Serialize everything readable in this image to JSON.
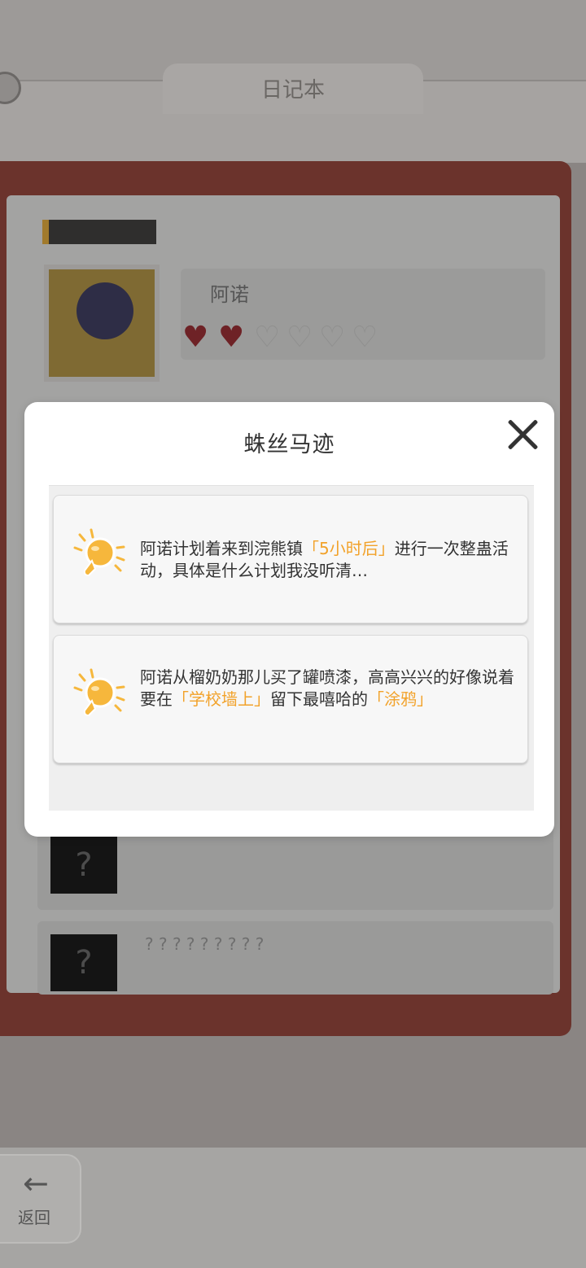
{
  "background": {
    "title": "日记本",
    "character_name": "阿诺",
    "hearts_full": 2,
    "hearts_total": 6,
    "unknown_mark": "?",
    "locked_line": "? ? ? ? ? ? ? ? ?",
    "back_label": "返回"
  },
  "modal": {
    "title": "蛛丝马迹",
    "clues": [
      {
        "parts": [
          {
            "text": "阿诺计划着来到浣熊镇",
            "highlight": false
          },
          {
            "text": "「5小时后」",
            "highlight": true
          },
          {
            "text": "进行一次整蛊活动，具体是什么计划我没听清…",
            "highlight": false
          }
        ]
      },
      {
        "parts": [
          {
            "text": "阿诺从榴奶奶那儿买了罐喷漆，高高兴兴的好像说着要在",
            "highlight": false
          },
          {
            "text": "「学校墙上」",
            "highlight": true
          },
          {
            "text": "留下最嘻哈的",
            "highlight": false
          },
          {
            "text": "「涂鸦」",
            "highlight": true
          }
        ]
      }
    ]
  },
  "colors": {
    "highlight": "#f2a22a",
    "bulb": "#f6b73c",
    "overlay_bg": "#8a8583"
  },
  "icons": [
    "gear-icon",
    "lightbulb-icon",
    "close-icon",
    "back-arrow-icon"
  ]
}
